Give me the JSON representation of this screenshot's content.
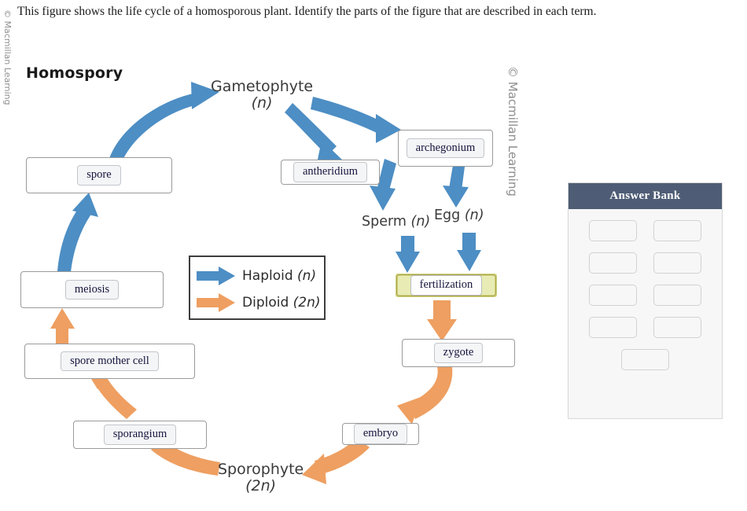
{
  "prompt": "This figure shows the life cycle of a homosporous plant. Identify the parts of the figure that are described in each term.",
  "watermarks": {
    "left": "© Macmillan Learning",
    "middle": "© Macmillan Learning"
  },
  "figure": {
    "title": "Homospory",
    "stages": [
      {
        "id": "gametophyte",
        "name": "Gametophyte",
        "ploidy": "(n)"
      },
      {
        "id": "sperm",
        "name": "Sperm",
        "ploidy": "(n)"
      },
      {
        "id": "egg",
        "name": "Egg",
        "ploidy": "(n)"
      },
      {
        "id": "sporophyte",
        "name": "Sporophyte",
        "ploidy": "(2n)"
      }
    ],
    "dropboxes": [
      {
        "id": "spore",
        "label": "spore",
        "highlighted": false
      },
      {
        "id": "meiosis",
        "label": "meiosis",
        "highlighted": false
      },
      {
        "id": "spore-mother-cell",
        "label": "spore mother cell",
        "highlighted": false
      },
      {
        "id": "sporangium",
        "label": "sporangium",
        "highlighted": false
      },
      {
        "id": "antheridium",
        "label": "antheridium",
        "highlighted": false
      },
      {
        "id": "archegonium",
        "label": "archegonium",
        "highlighted": false
      },
      {
        "id": "fertilization",
        "label": "fertilization",
        "highlighted": true
      },
      {
        "id": "zygote",
        "label": "zygote",
        "highlighted": false
      },
      {
        "id": "embryo",
        "label": "embryo",
        "highlighted": false
      }
    ],
    "legend": {
      "items": [
        {
          "id": "haploid",
          "label": "Haploid",
          "ploidy": "(n)",
          "color": "#4d8ec4"
        },
        {
          "id": "diploid",
          "label": "Diploid",
          "ploidy": "(2n)",
          "color": "#ee9f61"
        }
      ]
    }
  },
  "answer_bank": {
    "title": "Answer Bank",
    "slot_count": 9,
    "slots": [
      "",
      "",
      "",
      "",
      "",
      "",
      "",
      "",
      ""
    ]
  },
  "colors": {
    "haploid_arrow": "#4d8ec4",
    "diploid_arrow": "#ee9f61",
    "bank_header": "#4e5d75",
    "bank_body": "#f7f7f7",
    "box_border": "#9a9a9a",
    "highlight_border": "#ccd47f"
  }
}
